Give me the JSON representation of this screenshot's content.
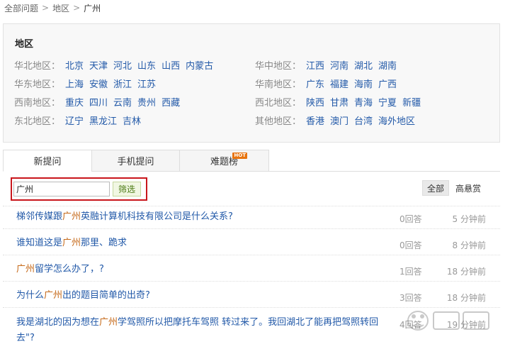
{
  "breadcrumb": {
    "items": [
      "全部问题",
      "地区",
      "广州"
    ],
    "separator": ">"
  },
  "region_panel": {
    "title": "地区",
    "left_groups": [
      {
        "label": "华北地区：",
        "links": [
          "北京",
          "天津",
          "河北",
          "山东",
          "山西",
          "内蒙古"
        ]
      },
      {
        "label": "华东地区：",
        "links": [
          "上海",
          "安徽",
          "浙江",
          "江苏"
        ]
      },
      {
        "label": "西南地区：",
        "links": [
          "重庆",
          "四川",
          "云南",
          "贵州",
          "西藏"
        ]
      },
      {
        "label": "东北地区：",
        "links": [
          "辽宁",
          "黑龙江",
          "吉林"
        ]
      }
    ],
    "right_groups": [
      {
        "label": "华中地区：",
        "links": [
          "江西",
          "河南",
          "湖北",
          "湖南"
        ]
      },
      {
        "label": "华南地区：",
        "links": [
          "广东",
          "福建",
          "海南",
          "广西"
        ]
      },
      {
        "label": "西北地区：",
        "links": [
          "陕西",
          "甘肃",
          "青海",
          "宁夏",
          "新疆"
        ]
      },
      {
        "label": "其他地区：",
        "links": [
          "香港",
          "澳门",
          "台湾",
          "海外地区"
        ]
      }
    ]
  },
  "tabs": {
    "new": "新提问",
    "mobile": "手机提问",
    "hard": "难题榜",
    "hot_badge": "HOT"
  },
  "filter": {
    "value": "广州",
    "button": "筛选"
  },
  "sort": {
    "all": "全部",
    "reward": "高悬赏"
  },
  "questions": [
    {
      "pre": "梯邻传媒跟",
      "hl": "广州",
      "post": "英融计算机科技有限公司是什么关系?",
      "answers": "0回答",
      "time": "5 分钟前"
    },
    {
      "pre": "谁知道这是",
      "hl": "广州",
      "post": "那里、跪求",
      "answers": "0回答",
      "time": "8 分钟前"
    },
    {
      "pre": "",
      "hl": "广州",
      "post": "留学怎么办了，?",
      "answers": "1回答",
      "time": "18 分钟前"
    },
    {
      "pre": "为什么",
      "hl": "广州",
      "post": "出的题目简单的出奇?",
      "answers": "3回答",
      "time": "18 分钟前"
    },
    {
      "pre": "我是湖北的因为想在",
      "hl": "广州",
      "post": "学驾照所以把摩托车驾照 转过来了。我回湖北了能再把驾照转回去\"?",
      "answers": "4回答",
      "time": "19 分钟前"
    }
  ],
  "colors": {
    "link": "#2259a8",
    "highlight": "#c66a1a",
    "callout_border": "#c9161c",
    "hot_badge": "#e8740e"
  },
  "watermark_icon": "baidu-jingyan-watermark"
}
